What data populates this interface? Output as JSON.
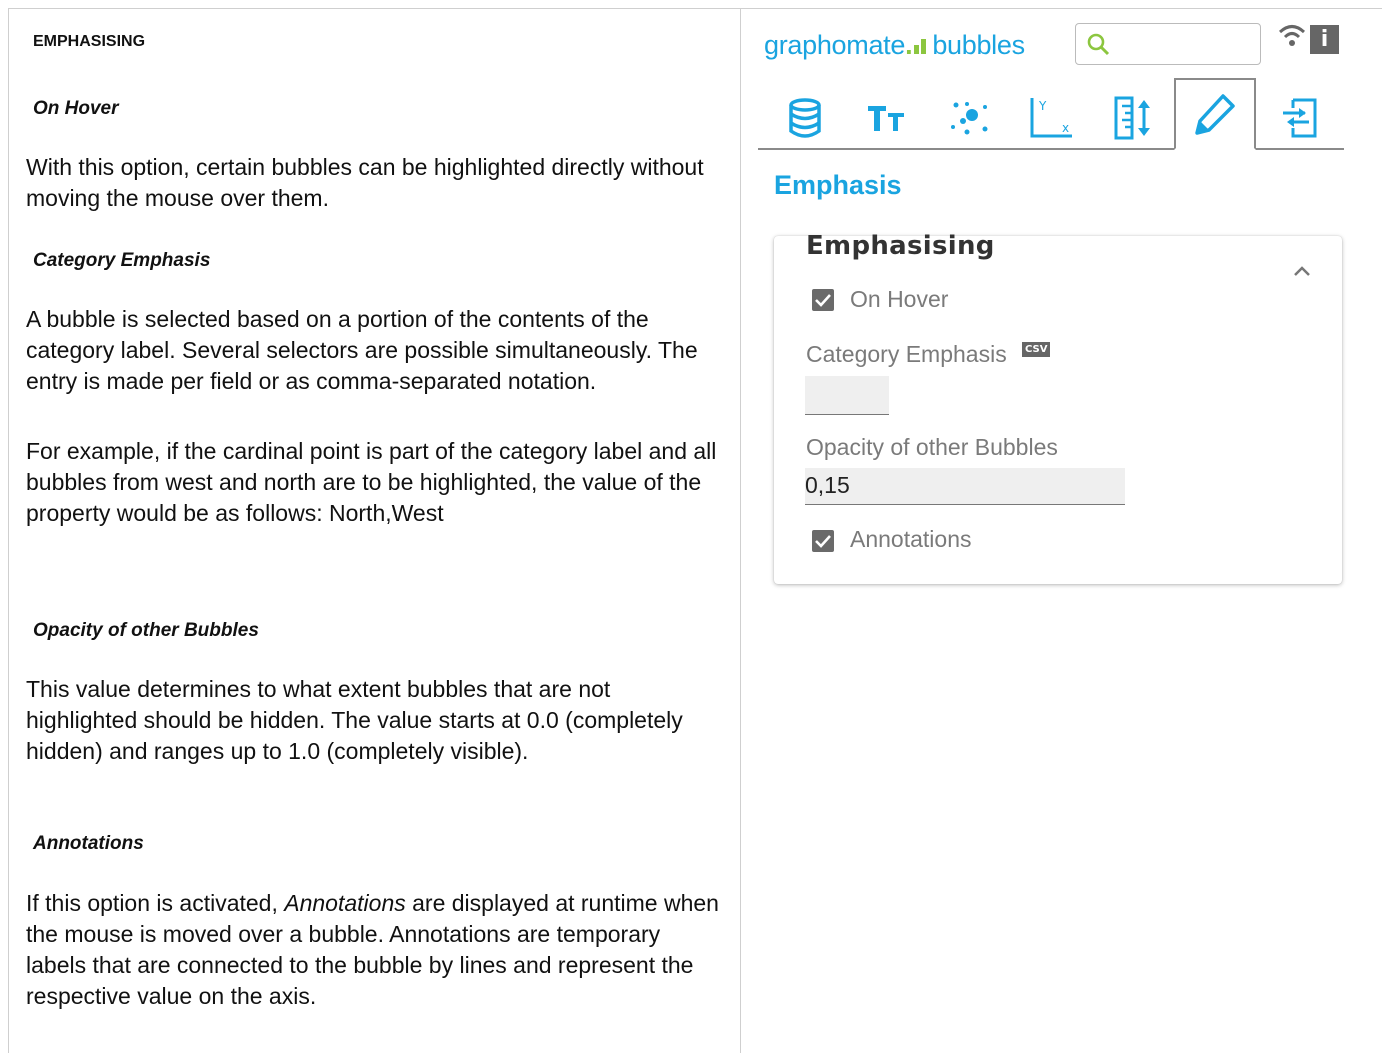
{
  "doc": {
    "main_heading": "EMPHASISING",
    "sections": [
      {
        "heading": "On Hover",
        "paragraphs": [
          "With this option, certain bubbles can be highlighted directly without moving the mouse over them."
        ]
      },
      {
        "heading": "Category Emphasis",
        "paragraphs": [
          "A bubble is selected based on a portion of the contents of the category label. Several selectors are possible simultaneously. The entry is made per field or as comma-separated notation.",
          "For example, if the cardinal point is part of the category label and all bubbles from west and north are to be highlighted, the value of the property would be as follows: North,West"
        ]
      },
      {
        "heading": "Opacity of other Bubbles",
        "paragraphs": [
          "This value determines to what extent bubbles that are not highlighted should be hidden. The value starts at 0.0 (completely hidden) and ranges up to 1.0 (completely visible)."
        ]
      },
      {
        "heading": "Annotations",
        "paragraphs_rich": {
          "lead": "If this option is activated, ",
          "em": "Annotations",
          "rest": " are displayed at runtime when the mouse is moved over a bubble. Annotations are temporary labels that are connected to the bubble by lines and represent the respective value on the axis."
        }
      }
    ]
  },
  "panel": {
    "brand": {
      "graph": "graphomate",
      "dot": ".",
      "product": "bubbles"
    },
    "search": {
      "value": "",
      "placeholder": ""
    },
    "info_label": "i",
    "tabs": [
      {
        "icon": "database-icon"
      },
      {
        "icon": "text-size-icon"
      },
      {
        "icon": "scatter-icon"
      },
      {
        "icon": "axis-icon"
      },
      {
        "icon": "ruler-icon"
      },
      {
        "icon": "pencil-icon",
        "active": true
      },
      {
        "icon": "export-icon"
      }
    ],
    "section_title": "Emphasis",
    "card": {
      "title": "Emphasising",
      "on_hover": {
        "label": "On Hover",
        "checked": true
      },
      "category_emphasis": {
        "label": "Category Emphasis",
        "badge": "CSV",
        "value": ""
      },
      "opacity": {
        "label": "Opacity of other Bubbles",
        "value": "0,15"
      },
      "annotations": {
        "label": "Annotations",
        "checked": true
      }
    },
    "colors": {
      "accent": "#1aa4e0",
      "brand_green": "#8cc63f",
      "checkbox": "#6a6a6a"
    }
  }
}
